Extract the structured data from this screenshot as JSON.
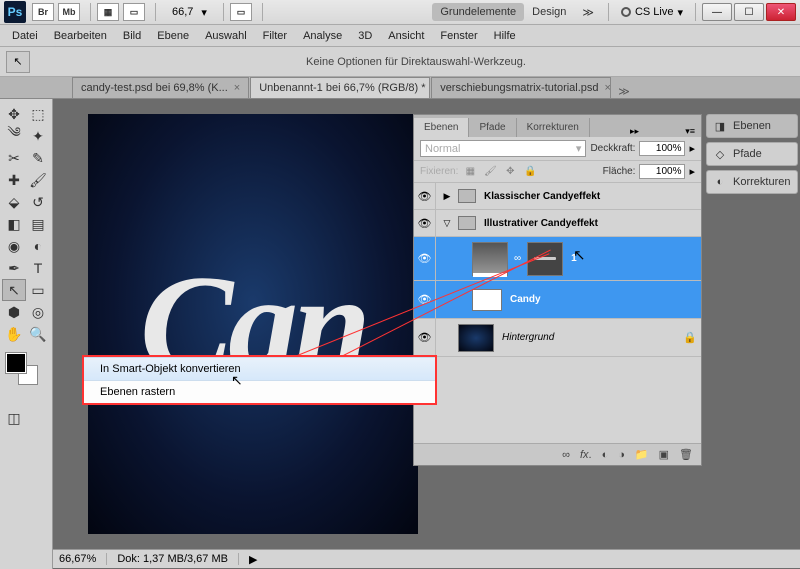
{
  "titlebar": {
    "app_abbr": "Ps",
    "bridge": "Br",
    "minibridge": "Mb",
    "zoom": "66,7",
    "workspace_active": "Grundelemente",
    "workspace_design": "Design",
    "more": "≫",
    "cs_live": "CS Live",
    "min": "—",
    "max": "☐",
    "close": "✕"
  },
  "menu": {
    "items": [
      "Datei",
      "Bearbeiten",
      "Bild",
      "Ebene",
      "Auswahl",
      "Filter",
      "Analyse",
      "3D",
      "Ansicht",
      "Fenster",
      "Hilfe"
    ]
  },
  "optbar": {
    "message": "Keine Optionen für Direktauswahl-Werkzeug."
  },
  "tabs": {
    "items": [
      {
        "label": "candy-test.psd bei 69,8% (K...",
        "active": false
      },
      {
        "label": "Unbenannt-1 bei 66,7% (RGB/8) *",
        "active": true
      },
      {
        "label": "verschiebungsmatrix-tutorial.psd",
        "active": false
      }
    ]
  },
  "canvas": {
    "artwork_text": "Can"
  },
  "ctxmenu": {
    "item_convert": "In Smart-Objekt konvertieren",
    "item_raster": "Ebenen rastern"
  },
  "panel": {
    "tabs": {
      "layers": "Ebenen",
      "paths": "Pfade",
      "corrections": "Korrekturen",
      "more": "▸▸"
    },
    "blend_mode": "Normal",
    "opacity_label": "Deckkraft:",
    "opacity_value": "100%",
    "lock_label": "Fixieren:",
    "fill_label": "Fläche:",
    "fill_value": "100%",
    "groups": {
      "g1": "Klassischer Candyeffekt",
      "g2": "Illustrativer Candyeffekt"
    },
    "layers": {
      "l1": "1",
      "l2": "Candy",
      "bg": "Hintergrund"
    }
  },
  "dock": {
    "layers": "Ebenen",
    "paths": "Pfade",
    "corrections": "Korrekturen"
  },
  "status": {
    "zoom": "66,67%",
    "doc": "Dok: 1,37 MB/3,67 MB"
  }
}
